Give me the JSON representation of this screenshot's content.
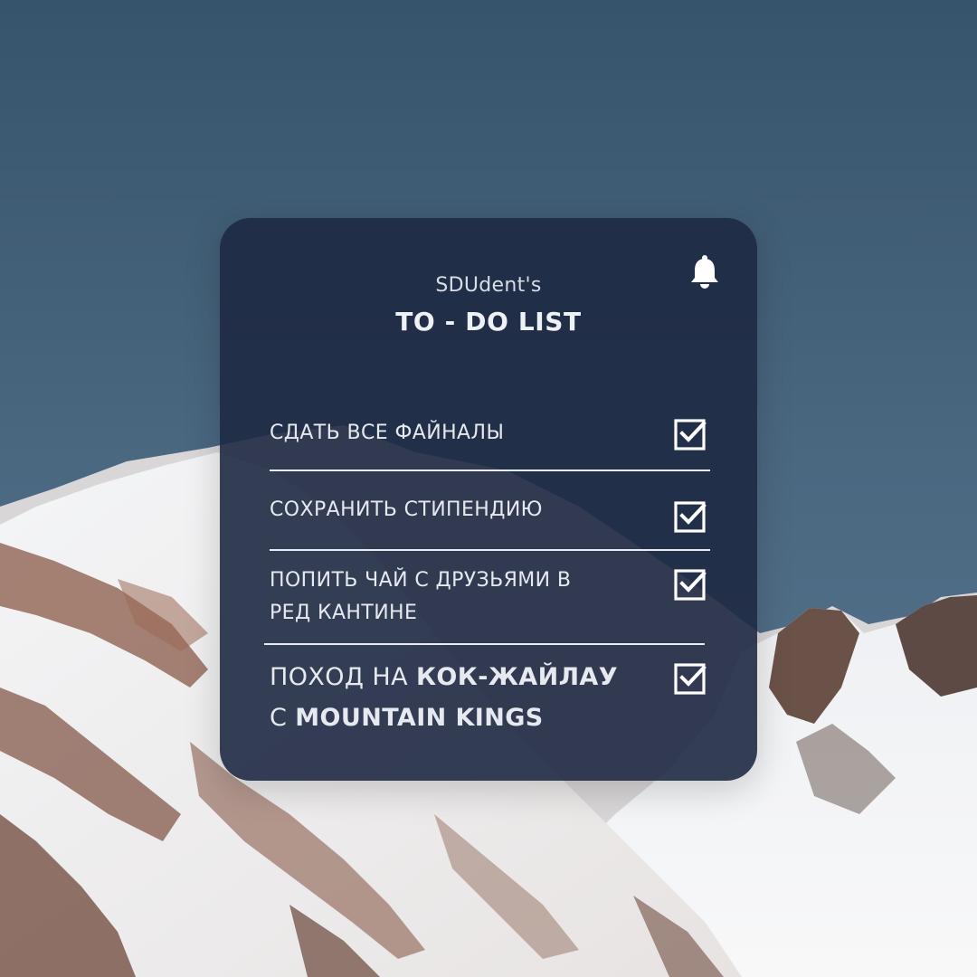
{
  "header": {
    "subtitle": "SDUdent's",
    "title": "TO - DO LIST"
  },
  "icons": {
    "notifications": "bell-icon",
    "checkbox": "checked-checkbox-icon"
  },
  "tasks": [
    {
      "text": "СДАТЬ ВСЕ ФАЙНАЛЫ",
      "checked": true
    },
    {
      "text": "СОХРАНИТЬ СТИПЕНДИЮ",
      "checked": true
    },
    {
      "line1": "ПОПИТЬ ЧАЙ С ДРУЗЬЯМИ В",
      "line2": "РЕД КАНТИНЕ",
      "checked": true
    },
    {
      "part1": "ПОХОД НА ",
      "part1_bold": "КОК-ЖАЙЛАУ",
      "part2": "С ",
      "part2_bold": "MOUNTAIN KINGS",
      "checked": true
    }
  ],
  "colors": {
    "card": "#1E2942",
    "sky": "#4A6680",
    "text": "#E6E9EF"
  }
}
